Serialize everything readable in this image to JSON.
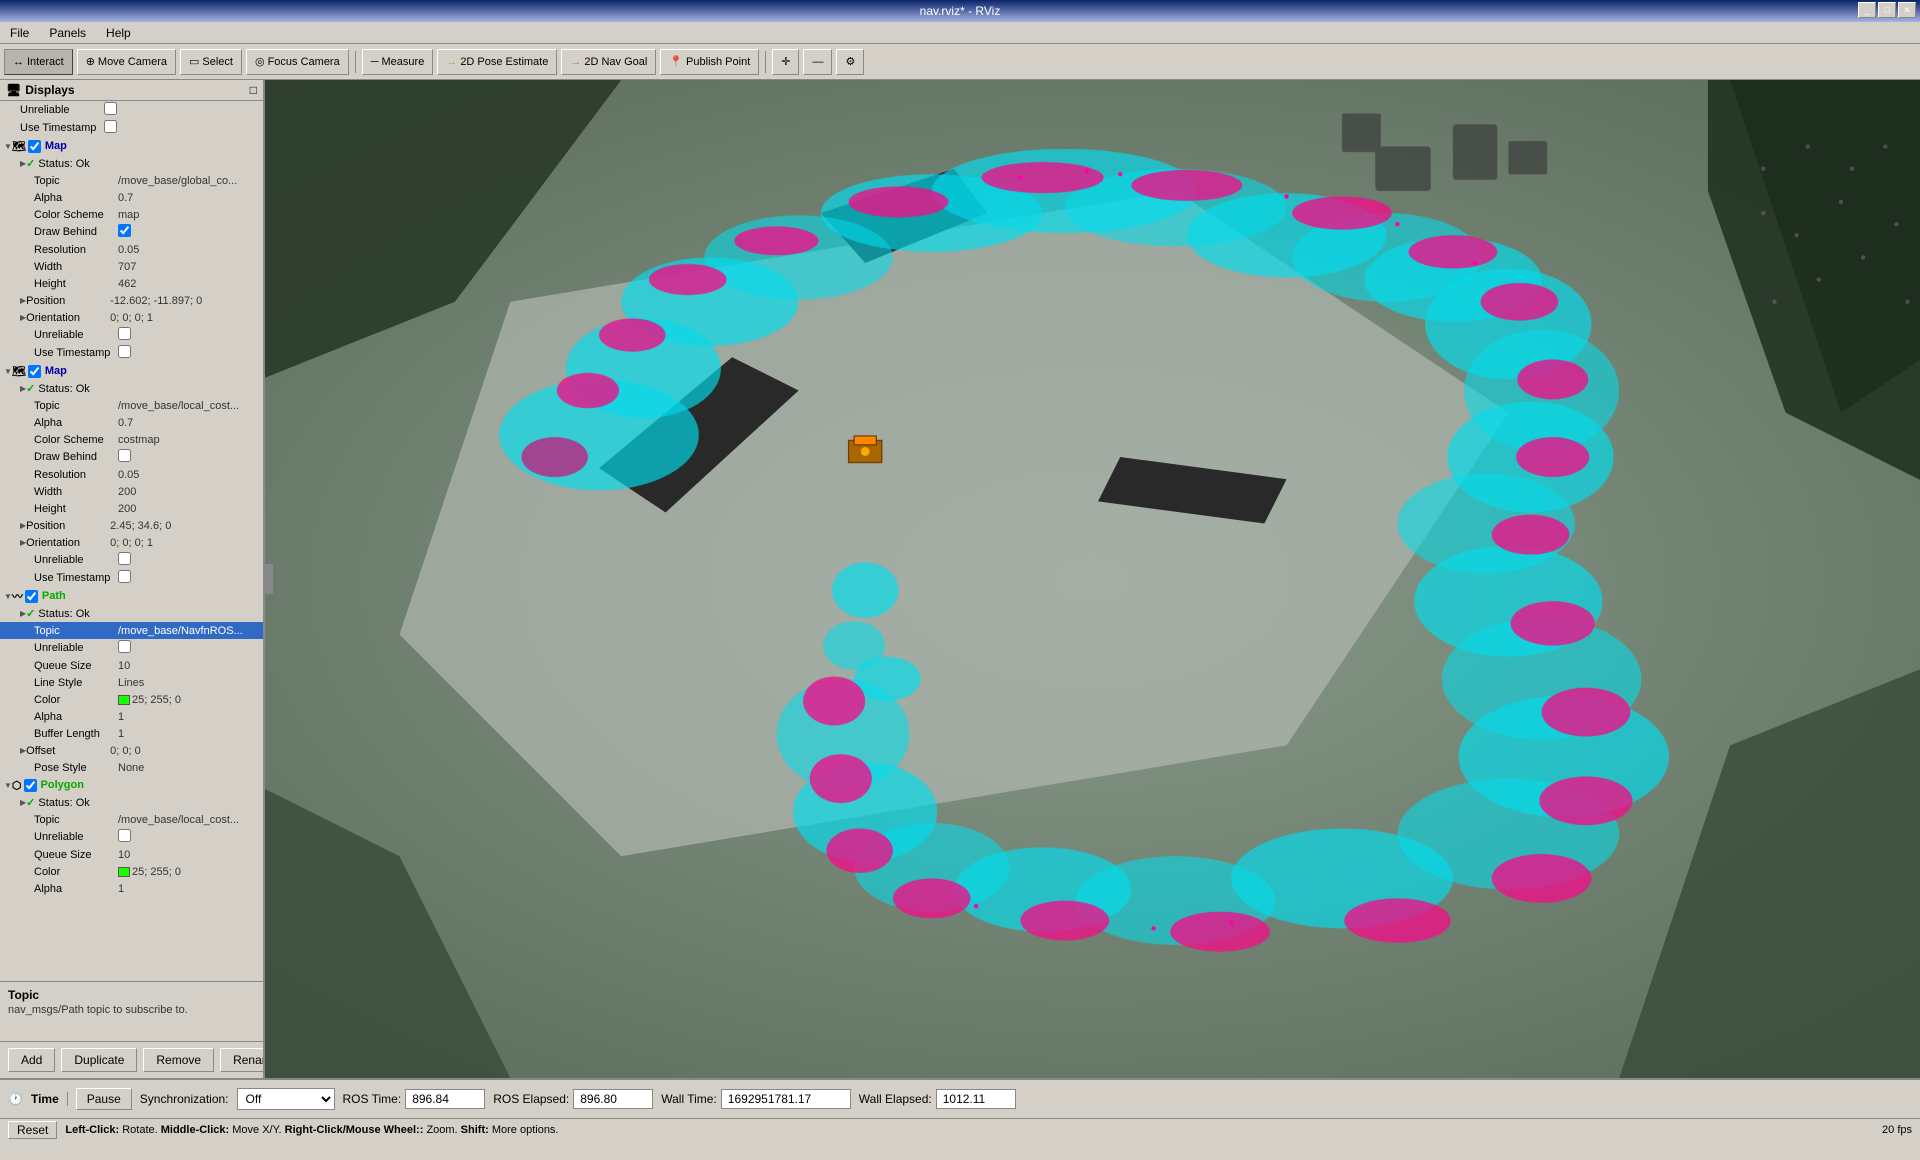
{
  "titlebar": {
    "title": "nav.rviz* - RViz"
  },
  "menubar": {
    "items": [
      "File",
      "Panels",
      "Help"
    ]
  },
  "toolbar": {
    "buttons": [
      {
        "label": "Interact",
        "icon": "↔",
        "active": true
      },
      {
        "label": "Move Camera",
        "icon": "⊕",
        "active": false
      },
      {
        "label": "Select",
        "icon": "▭",
        "active": false
      },
      {
        "label": "Focus Camera",
        "icon": "◎",
        "active": false
      },
      {
        "label": "Measure",
        "icon": "—",
        "active": false
      },
      {
        "label": "2D Pose Estimate",
        "icon": "→",
        "active": false
      },
      {
        "label": "2D Nav Goal",
        "icon": "→",
        "active": false
      },
      {
        "label": "Publish Point",
        "icon": "📍",
        "active": false
      }
    ],
    "extras": [
      "+",
      "—",
      "⚙"
    ]
  },
  "displays": {
    "header": "Displays",
    "sections": [
      {
        "type": "group",
        "label": "",
        "rows": [
          {
            "key": "Unreliable",
            "value": "",
            "checkbox": true,
            "checked": false,
            "indent": 0
          },
          {
            "key": "Use Timestamp",
            "value": "",
            "checkbox": true,
            "checked": false,
            "indent": 0
          }
        ]
      },
      {
        "type": "section",
        "label": "Map",
        "icon": "map",
        "checked": true,
        "expanded": true,
        "rows": [
          {
            "key": "Status: Ok",
            "value": "",
            "isStatus": true,
            "indent": 1
          },
          {
            "key": "Topic",
            "value": "/move_base/global_co...",
            "indent": 1
          },
          {
            "key": "Alpha",
            "value": "0.7",
            "indent": 1
          },
          {
            "key": "Color Scheme",
            "value": "map",
            "indent": 1
          },
          {
            "key": "Draw Behind",
            "value": "",
            "checkbox": true,
            "checked": true,
            "indent": 1
          },
          {
            "key": "Resolution",
            "value": "0.05",
            "indent": 1
          },
          {
            "key": "Width",
            "value": "707",
            "indent": 1
          },
          {
            "key": "Height",
            "value": "462",
            "indent": 1
          },
          {
            "key": "Position",
            "value": "-12.602; -11.897; 0",
            "indent": 1,
            "expandable": true
          },
          {
            "key": "Orientation",
            "value": "0; 0; 0; 1",
            "indent": 1,
            "expandable": true
          },
          {
            "key": "Unreliable",
            "value": "",
            "checkbox": true,
            "checked": false,
            "indent": 1
          },
          {
            "key": "Use Timestamp",
            "value": "",
            "checkbox": true,
            "checked": false,
            "indent": 1
          }
        ]
      },
      {
        "type": "section",
        "label": "Map",
        "icon": "map",
        "checked": true,
        "expanded": true,
        "rows": [
          {
            "key": "Status: Ok",
            "value": "",
            "isStatus": true,
            "indent": 1
          },
          {
            "key": "Topic",
            "value": "/move_base/local_cost...",
            "indent": 1
          },
          {
            "key": "Alpha",
            "value": "0.7",
            "indent": 1
          },
          {
            "key": "Color Scheme",
            "value": "costmap",
            "indent": 1
          },
          {
            "key": "Draw Behind",
            "value": "",
            "checkbox": true,
            "checked": false,
            "indent": 1
          },
          {
            "key": "Resolution",
            "value": "0.05",
            "indent": 1
          },
          {
            "key": "Width",
            "value": "200",
            "indent": 1
          },
          {
            "key": "Height",
            "value": "200",
            "indent": 1
          },
          {
            "key": "Position",
            "value": "2.45; 34.6; 0",
            "indent": 1,
            "expandable": true
          },
          {
            "key": "Orientation",
            "value": "0; 0; 0; 1",
            "indent": 1,
            "expandable": true
          },
          {
            "key": "Unreliable",
            "value": "",
            "checkbox": true,
            "checked": false,
            "indent": 1
          },
          {
            "key": "Use Timestamp",
            "value": "",
            "checkbox": true,
            "checked": false,
            "indent": 1
          }
        ]
      },
      {
        "type": "section",
        "label": "Path",
        "icon": "path",
        "checked": true,
        "expanded": true,
        "selected": false,
        "rows": [
          {
            "key": "Status: Ok",
            "value": "",
            "isStatus": true,
            "indent": 1
          },
          {
            "key": "Topic",
            "value": "/move_base/NavfnROS...",
            "indent": 1,
            "selected": true
          },
          {
            "key": "Unreliable",
            "value": "",
            "checkbox": true,
            "checked": false,
            "indent": 1
          },
          {
            "key": "Queue Size",
            "value": "10",
            "indent": 1
          },
          {
            "key": "Line Style",
            "value": "Lines",
            "indent": 1
          },
          {
            "key": "Color",
            "value": "25; 255; 0",
            "indent": 1,
            "hasColor": true
          },
          {
            "key": "Alpha",
            "value": "1",
            "indent": 1
          },
          {
            "key": "Buffer Length",
            "value": "1",
            "indent": 1
          },
          {
            "key": "Offset",
            "value": "0; 0; 0",
            "indent": 1,
            "expandable": true
          },
          {
            "key": "Pose Style",
            "value": "None",
            "indent": 1
          }
        ]
      },
      {
        "type": "section",
        "label": "Polygon",
        "icon": "polygon",
        "checked": true,
        "expanded": true,
        "rows": [
          {
            "key": "Status: Ok",
            "value": "",
            "isStatus": true,
            "indent": 1
          },
          {
            "key": "Topic",
            "value": "/move_base/local_cost...",
            "indent": 1
          },
          {
            "key": "Unreliable",
            "value": "",
            "checkbox": true,
            "checked": false,
            "indent": 1
          },
          {
            "key": "Queue Size",
            "value": "10",
            "indent": 1
          },
          {
            "key": "Color",
            "value": "25; 255; 0",
            "indent": 1,
            "hasColor": true
          },
          {
            "key": "Alpha",
            "value": "1",
            "indent": 1
          }
        ]
      }
    ]
  },
  "tooltip": {
    "title": "Topic",
    "text": "nav_msgs/Path topic to subscribe to."
  },
  "buttons": [
    "Add",
    "Duplicate",
    "Remove",
    "Rename"
  ],
  "time_panel": {
    "label": "Time",
    "pause_label": "Pause",
    "sync_label": "Synchronization:",
    "sync_value": "Off",
    "ros_time_label": "ROS Time:",
    "ros_time_value": "896.84",
    "ros_elapsed_label": "ROS Elapsed:",
    "ros_elapsed_value": "896.80",
    "wall_time_label": "Wall Time:",
    "wall_time_value": "1692951781.17",
    "wall_elapsed_label": "Wall Elapsed:",
    "wall_elapsed_value": "1012.11"
  },
  "statusbar": {
    "reset_label": "Reset",
    "instructions": "Left-Click: Rotate.  Middle-Click: Move X/Y.  Right-Click/Mouse Wheel:: Zoom.  Shift: More options.",
    "fps": "20 fps"
  }
}
